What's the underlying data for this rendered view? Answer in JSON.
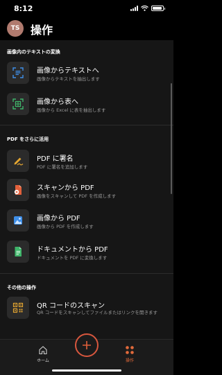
{
  "status_bar": {
    "time": "8:12",
    "battery_level": 0.9
  },
  "header": {
    "avatar_initials": "TS",
    "title": "操作"
  },
  "sections": [
    {
      "title": "画像内のテキストの変換",
      "items": [
        {
          "title": "画像からテキストへ",
          "subtitle": "画像からテキストを抽出します",
          "icon": "scan-text-icon"
        },
        {
          "title": "画像から表へ",
          "subtitle": "画像から Excel に表を抽出します",
          "icon": "scan-table-icon"
        }
      ]
    },
    {
      "title": "PDF をさらに活用",
      "items": [
        {
          "title": "PDF に署名",
          "subtitle": "PDF に署名を追加します",
          "icon": "pen-sign-icon"
        },
        {
          "title": "スキャンから PDF",
          "subtitle": "画像をスキャンして PDF を作成します",
          "icon": "scan-pdf-icon"
        },
        {
          "title": "画像から PDF",
          "subtitle": "画像から PDF を作成します",
          "icon": "image-pdf-icon"
        },
        {
          "title": "ドキュメントから PDF",
          "subtitle": "ドキュメントを PDF に変換します",
          "icon": "document-pdf-icon"
        }
      ]
    },
    {
      "title": "その他の操作",
      "items": [
        {
          "title": "QR コードのスキャン",
          "subtitle": "QR コードをスキャンしてファイルまたはリンクを開きます",
          "icon": "qr-code-icon"
        }
      ]
    }
  ],
  "tabbar": {
    "home_label": "ホーム",
    "actions_label": "操作"
  },
  "colors": {
    "accent": "#e26a3b",
    "blue": "#3f8fe8",
    "green": "#3fb56a",
    "gold": "#e3a531",
    "pdf_red": "#e2603b"
  }
}
